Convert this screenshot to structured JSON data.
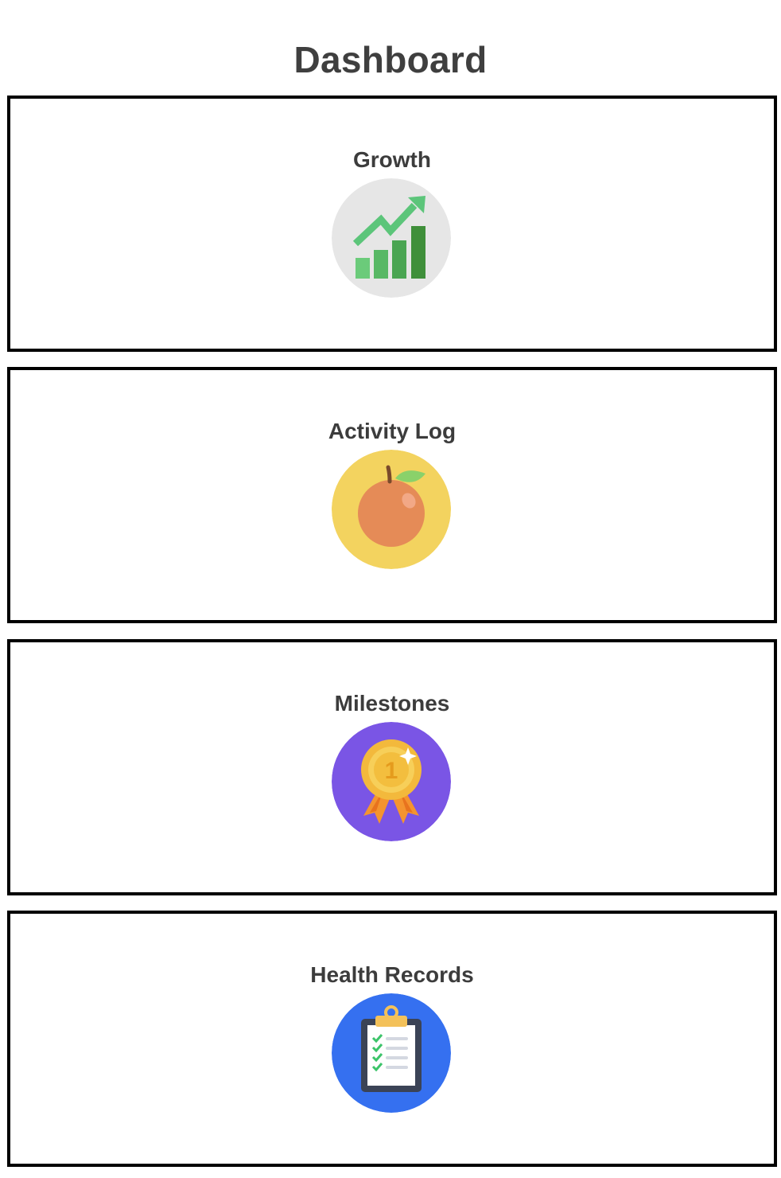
{
  "page": {
    "title": "Dashboard"
  },
  "cards": [
    {
      "label": "Growth",
      "icon": "growth-chart-icon",
      "color": "#e6e6e6"
    },
    {
      "label": "Activity Log",
      "icon": "orange-fruit-icon",
      "color": "#f3d35f"
    },
    {
      "label": "Milestones",
      "icon": "award-medal-icon",
      "color": "#7a55e5"
    },
    {
      "label": "Health Records",
      "icon": "clipboard-checklist-icon",
      "color": "#3570f0"
    }
  ]
}
